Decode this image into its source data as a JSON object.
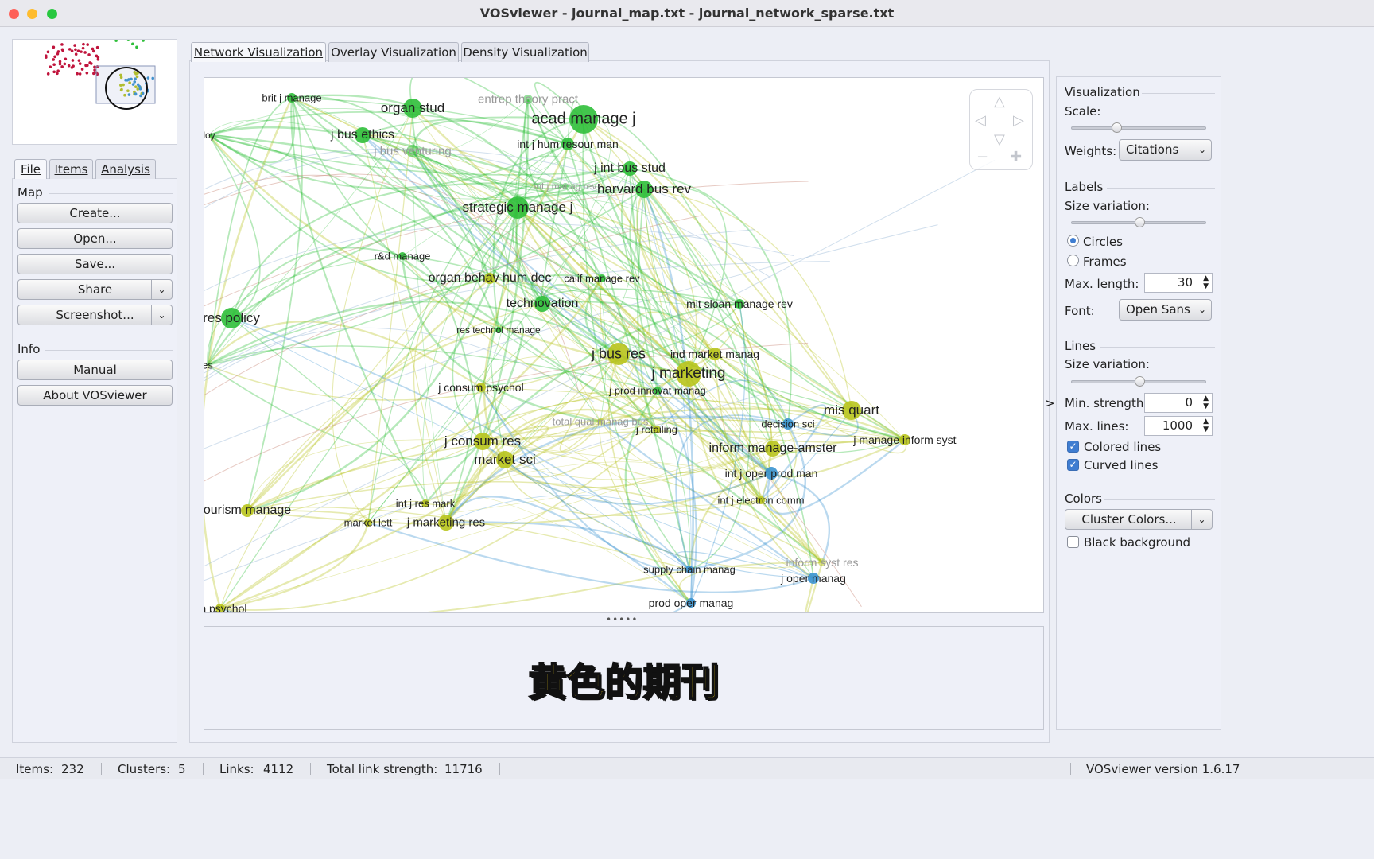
{
  "window": {
    "title": "VOSviewer - journal_map.txt - journal_network_sparse.txt"
  },
  "left": {
    "tabs": [
      "File",
      "Items",
      "Analysis"
    ],
    "map_heading": "Map",
    "buttons": {
      "create": "Create...",
      "open": "Open...",
      "save": "Save...",
      "share": "Share",
      "screenshot": "Screenshot..."
    },
    "info_heading": "Info",
    "info_buttons": {
      "manual": "Manual",
      "about": "About VOSviewer"
    }
  },
  "main": {
    "tabs": [
      "Network Visualization",
      "Overlay Visualization",
      "Density Visualization"
    ],
    "active_tab": 0
  },
  "colors": {
    "green": "#2fbf3a",
    "yellow": "#b8c41c",
    "blue": "#3a93d0",
    "red": "#c0143c",
    "purple": "#7a3fa0"
  },
  "network": {
    "nodes": [
      {
        "label": "brit j manage",
        "c": "green"
      },
      {
        "label": "organ stud",
        "c": "green"
      },
      {
        "label": "entrep theory pract",
        "c": "green",
        "faded": true
      },
      {
        "label": "acad manage j",
        "c": "green"
      },
      {
        "label": "j bus ethics",
        "c": "green"
      },
      {
        "label": "loy",
        "c": "green"
      },
      {
        "label": "j bus venturing",
        "c": "green",
        "faded": true
      },
      {
        "label": "int j hum resour man",
        "c": "green"
      },
      {
        "label": "j int bus stud",
        "c": "green"
      },
      {
        "label": "int j manag rev",
        "c": "green",
        "faded": true
      },
      {
        "label": "harvard bus rev",
        "c": "green"
      },
      {
        "label": "strategic manage j",
        "c": "green"
      },
      {
        "label": "r&d manage",
        "c": "green"
      },
      {
        "label": "organ behav hum dec",
        "c": "yellow"
      },
      {
        "label": "calif manage rev",
        "c": "green"
      },
      {
        "label": "technovation",
        "c": "green"
      },
      {
        "label": "mit sloan manage rev",
        "c": "green"
      },
      {
        "label": "res policy",
        "c": "green"
      },
      {
        "label": "res technol manage",
        "c": "green"
      },
      {
        "label": "j bus res",
        "c": "yellow"
      },
      {
        "label": "ind market manag",
        "c": "yellow"
      },
      {
        "label": "es",
        "c": "green"
      },
      {
        "label": "j marketing",
        "c": "yellow"
      },
      {
        "label": "j consum psychol",
        "c": "yellow"
      },
      {
        "label": "j prod innovat manag",
        "c": "green"
      },
      {
        "label": "total qual manag bus",
        "c": "yellow",
        "faded": true
      },
      {
        "label": "j retailing",
        "c": "yellow"
      },
      {
        "label": "mis quart",
        "c": "yellow"
      },
      {
        "label": "decision sci",
        "c": "blue"
      },
      {
        "label": "j manage inform syst",
        "c": "yellow"
      },
      {
        "label": "j consum res",
        "c": "yellow"
      },
      {
        "label": "market sci",
        "c": "yellow"
      },
      {
        "label": "inform manage-amster",
        "c": "yellow"
      },
      {
        "label": "int j oper prod man",
        "c": "blue"
      },
      {
        "label": "int j electron comm",
        "c": "yellow"
      },
      {
        "label": "ourism manage",
        "c": "yellow"
      },
      {
        "label": "int j res mark",
        "c": "yellow"
      },
      {
        "label": "market lett",
        "c": "yellow"
      },
      {
        "label": "j marketing res",
        "c": "yellow"
      },
      {
        "label": "inform syst res",
        "c": "yellow",
        "faded": true
      },
      {
        "label": "supply chain manag",
        "c": "blue"
      },
      {
        "label": "j oper manag",
        "c": "blue"
      },
      {
        "label": "prod oper manag",
        "c": "blue"
      },
      {
        "label": "on psychol",
        "c": "yellow"
      }
    ]
  },
  "subtitle": "黄色的期刊",
  "right": {
    "visualization": "Visualization",
    "scale": "Scale:",
    "scale_value": 0.32,
    "weights": "Weights:",
    "weights_value": "Citations",
    "labels": "Labels",
    "size_variation": "Size variation:",
    "labels_size_value": 0.5,
    "circles": "Circles",
    "frames": "Frames",
    "label_mode": "Circles",
    "max_length": "Max. length:",
    "max_length_value": "30",
    "font": "Font:",
    "font_value": "Open Sans",
    "lines": "Lines",
    "lines_size_value": 0.5,
    "min_strength": "Min. strength:",
    "min_strength_value": "0",
    "max_lines": "Max. lines:",
    "max_lines_value": "1000",
    "colored_lines": "Colored lines",
    "colored_lines_checked": true,
    "curved_lines": "Curved lines",
    "curved_lines_checked": true,
    "colors": "Colors",
    "cluster_colors": "Cluster Colors...",
    "black_background": "Black background",
    "black_background_checked": false
  },
  "status": {
    "items_label": "Items:",
    "items": "232",
    "clusters_label": "Clusters:",
    "clusters": "5",
    "links_label": "Links:",
    "links": "4112",
    "tls_label": "Total link strength:",
    "tls": "11716",
    "version": "VOSviewer version 1.6.17"
  }
}
